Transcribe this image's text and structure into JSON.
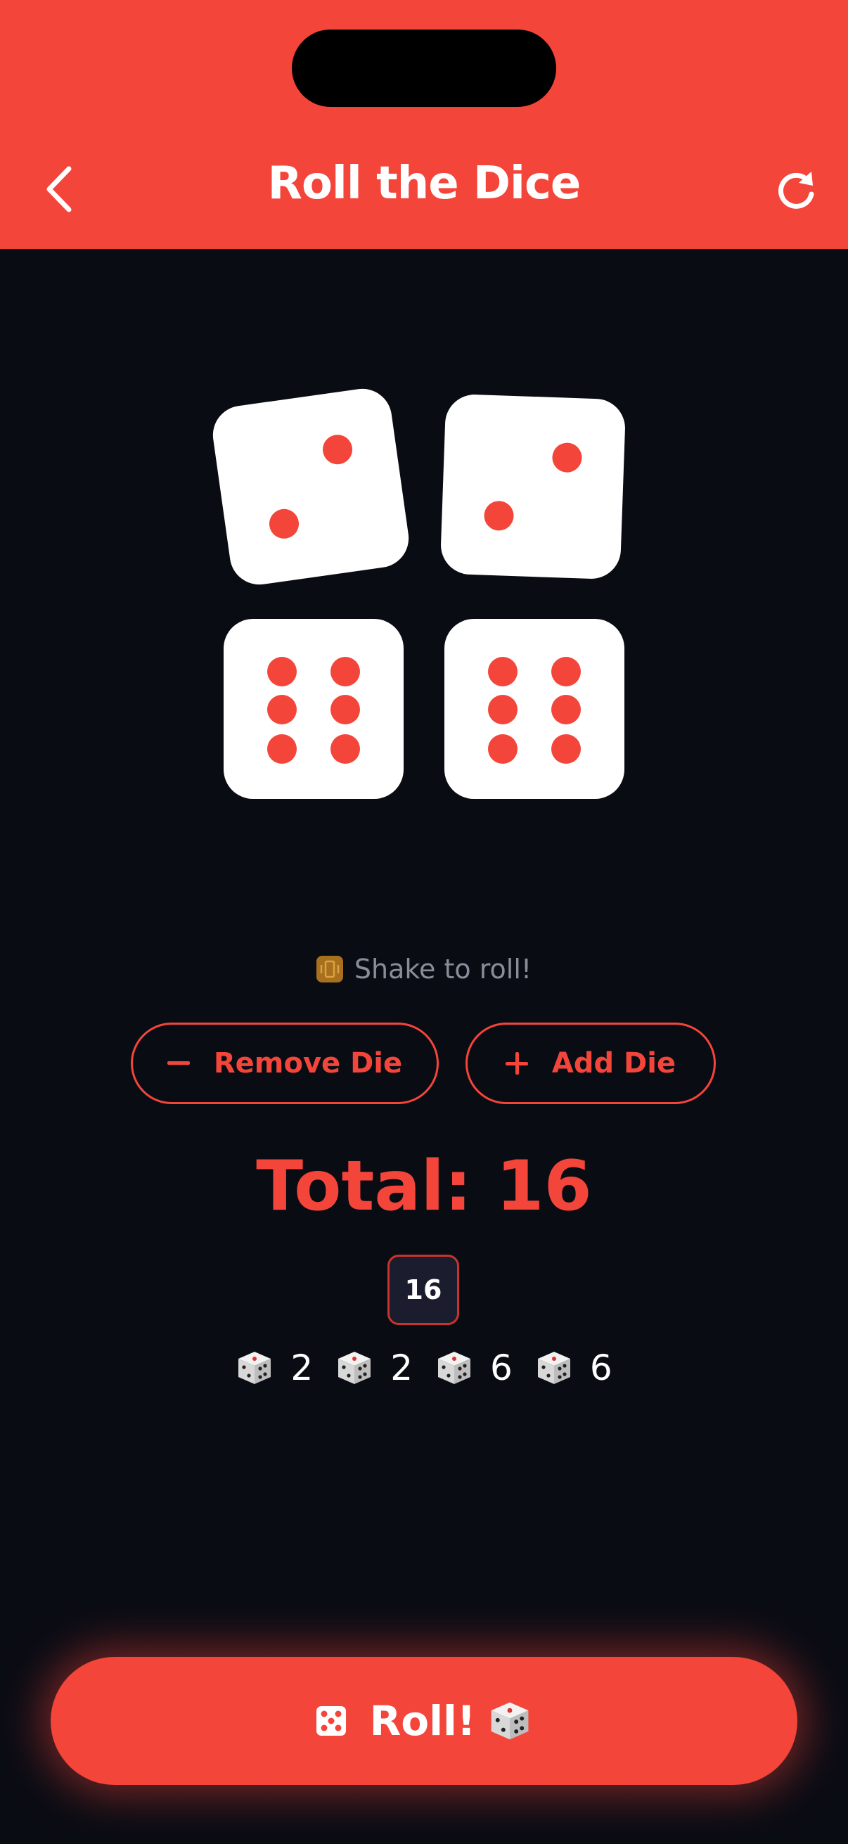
{
  "header": {
    "title": "Roll the Dice",
    "back_icon": "chevron-left-icon",
    "refresh_icon": "refresh-icon"
  },
  "dice": [
    {
      "value": 2
    },
    {
      "value": 2
    },
    {
      "value": 6
    },
    {
      "value": 6
    }
  ],
  "hint": {
    "text": "Shake to roll!",
    "icon": "vibrating-phone-icon"
  },
  "buttons": {
    "remove_label": "Remove Die",
    "add_label": "Add Die"
  },
  "total": {
    "text": "Total: 16",
    "chip": "16"
  },
  "breakdown": [
    "2",
    "2",
    "6",
    "6"
  ],
  "roll": {
    "label": "Roll!"
  },
  "colors": {
    "accent": "#f4453a",
    "background": "#0a0c14",
    "chip_bg": "#1b1d2e"
  }
}
